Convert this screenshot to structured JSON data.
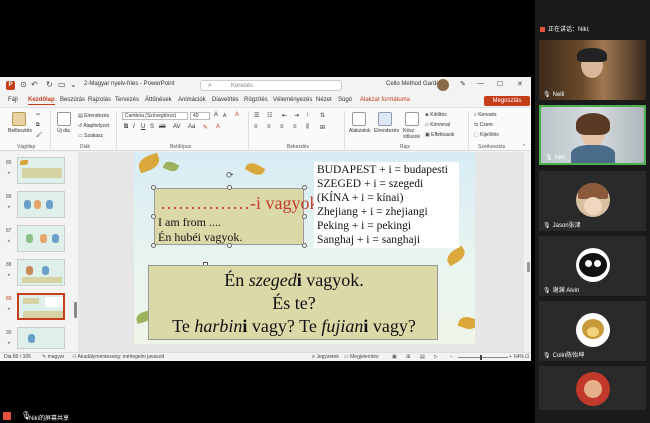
{
  "window": {
    "doc_title": "2-Magyar nyelv-fries - PowerPoint",
    "search_placeholder": "Keresés",
    "user_name": "Cello Method Gardian",
    "min": "—",
    "max": "☐",
    "close": "✕"
  },
  "menu": {
    "tabs": [
      "Fájl",
      "Kezdőlap",
      "Beszúrás",
      "Rajzolás",
      "Tervezés",
      "Áttűnések",
      "Animációk",
      "Diavetítés",
      "Rögzítés",
      "Véleményezés",
      "Nézet",
      "Súgó",
      "Alakzat formátuma"
    ],
    "share_label": "Megosztás"
  },
  "ribbon": {
    "paste": "Beillesztés",
    "new_slide": "Új dia",
    "layout": "Elrendezés",
    "reset": "Alaphelyzet",
    "section": "Szakasz",
    "font_name": "Cambria (Szövegtörzs)",
    "font_size": "40",
    "shapes": "Alakzatok",
    "arrange": "Elrendezés",
    "quick_styles": "Kész stílusok",
    "fill": "Kitöltés",
    "outline": "Körvonal",
    "effects": "Effektusok",
    "find": "Keresés",
    "replace": "Csere",
    "select": "Kijelölés",
    "group_clipboard": "Vágólap",
    "group_slides": "Diák",
    "group_font": "Betűtípus",
    "group_paragraph": "Bekezdés",
    "group_drawing": "Rajz",
    "group_editing": "Szerkesztés"
  },
  "thumbnails": {
    "numbers": [
      "85",
      "86",
      "87",
      "88",
      "89",
      "90"
    ],
    "selected_index": 4
  },
  "slide": {
    "left_box": {
      "title_dots": "……………",
      "title_suffix": "-i vagyok.",
      "line1": "I am from ....",
      "line2": "Én hubéi vagyok."
    },
    "right_box": {
      "lines": [
        "BUDAPEST + i = budapesti",
        "SZEGED + i = szegedi",
        "(KÍNA + i = kínai)",
        "Zhejiang + i = zhejiangi",
        "Peking + i = pekingi",
        "Sanghaj + i = sanghaji"
      ]
    },
    "bottom_box": {
      "line1_pre": "Én ",
      "line1_em": "szeged",
      "line1_strong": "i",
      "line1_post": " vagyok.",
      "line2": "És te?",
      "line3_pre": "Te ",
      "line3_em1": "harbin",
      "line3_strong1": "i",
      "line3_mid": " vagy? Te ",
      "line3_em2": "fujian",
      "line3_strong2": "i",
      "line3_post": " vagy?"
    }
  },
  "status": {
    "slide_info": "Dia 89 / 106",
    "language": "magyar",
    "accessibility": "Akadálymentesség: mérlegelni javasolt",
    "notes": "Jegyzetek",
    "display": "Megjelenítés",
    "zoom": "64%"
  },
  "share_bar": {
    "text": "Niki的屏幕共享"
  },
  "panel": {
    "speaking": "正在讲话：Niki;",
    "participants": [
      {
        "name": "Nelli"
      },
      {
        "name": "Niki"
      },
      {
        "name": "Jason张津"
      },
      {
        "name": "谢渊 Alvin"
      },
      {
        "name": "Colin陈怡坤"
      },
      {
        "name": ""
      }
    ]
  },
  "colors": {
    "accent": "#c43e1c",
    "slide_box": "#dcd9a8",
    "title_red": "#c0392b",
    "active_border": "#4caf50"
  }
}
